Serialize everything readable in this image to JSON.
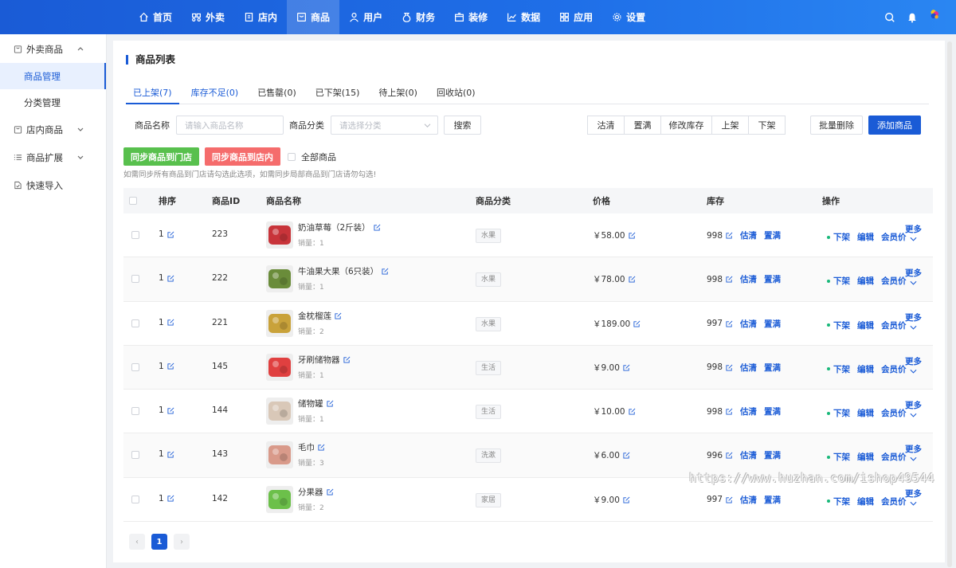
{
  "topnav": [
    {
      "label": "首页",
      "icon": "home-icon"
    },
    {
      "label": "外卖",
      "icon": "scooter-icon"
    },
    {
      "label": "店内",
      "icon": "store-icon"
    },
    {
      "label": "商品",
      "icon": "goods-icon",
      "active": true
    },
    {
      "label": "用户",
      "icon": "user-icon"
    },
    {
      "label": "财务",
      "icon": "finance-icon"
    },
    {
      "label": "装修",
      "icon": "decor-icon"
    },
    {
      "label": "数据",
      "icon": "chart-icon"
    },
    {
      "label": "应用",
      "icon": "apps-icon"
    },
    {
      "label": "设置",
      "icon": "gear-icon"
    }
  ],
  "sidebar": {
    "group1": "外卖商品",
    "sub1": "商品管理",
    "sub2": "分类管理",
    "group2": "店内商品",
    "group3": "商品扩展",
    "group4": "快速导入"
  },
  "page_title": "商品列表",
  "tabs": [
    "已上架(7)",
    "库存不足(0)",
    "已售罄(0)",
    "已下架(15)",
    "待上架(0)",
    "回收站(0)"
  ],
  "filter": {
    "name_label": "商品名称",
    "name_placeholder": "请输入商品名称",
    "cat_label": "商品分类",
    "cat_placeholder": "请选择分类",
    "search": "搜索"
  },
  "actions": [
    "沽清",
    "置满",
    "修改库存",
    "上架",
    "下架"
  ],
  "batch_delete": "批量删除",
  "add_goods": "添加商品",
  "sync_store": "同步商品到门店",
  "sync_in": "同步商品到店内",
  "all_goods": "全部商品",
  "hint": "如需同步所有商品到门店请勾选此选项，如需同步局部商品到门店请勿勾选!",
  "columns": [
    "排序",
    "商品ID",
    "商品名称",
    "商品分类",
    "价格",
    "库存",
    "操作"
  ],
  "rows": [
    {
      "sort": "1",
      "id": "223",
      "name": "奶油草莓（2斤装）",
      "sales": "销量：1",
      "category": "水果",
      "price": "￥58.00",
      "stock": "998",
      "thumb": "#c8343a"
    },
    {
      "sort": "1",
      "id": "222",
      "name": "牛油果大果（6只装）",
      "sales": "销量：1",
      "category": "水果",
      "price": "￥78.00",
      "stock": "998",
      "thumb": "#6a8c3a"
    },
    {
      "sort": "1",
      "id": "221",
      "name": "金枕榴莲",
      "sales": "销量：2",
      "category": "水果",
      "price": "￥189.00",
      "stock": "997",
      "thumb": "#c9a23a"
    },
    {
      "sort": "1",
      "id": "145",
      "name": "牙刷储物器",
      "sales": "销量：1",
      "category": "生活",
      "price": "￥9.00",
      "stock": "998",
      "thumb": "#e04040"
    },
    {
      "sort": "1",
      "id": "144",
      "name": "储物罐",
      "sales": "销量：1",
      "category": "生活",
      "price": "￥10.00",
      "stock": "998",
      "thumb": "#d9c8b8"
    },
    {
      "sort": "1",
      "id": "143",
      "name": "毛巾",
      "sales": "销量：3",
      "category": "洗漱",
      "price": "￥6.00",
      "stock": "996",
      "thumb": "#d99a8a"
    },
    {
      "sort": "1",
      "id": "142",
      "name": "分果器",
      "sales": "销量：2",
      "category": "家居",
      "price": "￥9.00",
      "stock": "997",
      "thumb": "#6cc04a"
    }
  ],
  "row_ops": {
    "estimate": "估清",
    "fill": "置满",
    "off": "下架",
    "edit": "编辑",
    "member_price": "会员价",
    "more": "更多"
  },
  "pager": {
    "prev": "‹",
    "current": "1",
    "next": "›"
  },
  "watermark": "https://www.huzhan.com/ishop49544",
  "colors": {
    "primary": "#1a5bd6",
    "green": "#58c04d",
    "red": "#f56c6c",
    "online_dot": "#19b87a"
  }
}
